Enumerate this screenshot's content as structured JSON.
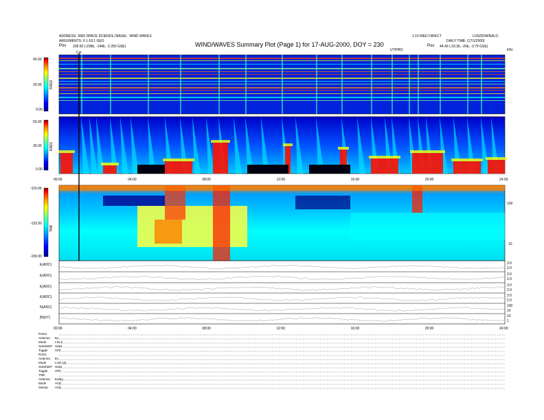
{
  "header": {
    "left_line1": "ADDRESS: 3000 SPACE SCIENCE (NASA) - WIND WAVES",
    "left_line2": "ARGUMENTS: 0.1-18.1 GEO",
    "left_pos_label": "Pos",
    "left_pos_value": "228.50 (-238b, -144b, -2.250 GSE)",
    "right_line1": "LOS/DOWN/A.D.",
    "right_line2": "DAILY TIME: (17/1/2000)",
    "right_pos_label": "Pos",
    "right_pos_value": "44.40 (-33.3b, -26b, -3.79 GSE)",
    "center_small": "1:10 WED DIRECT",
    "title": "WIND/WAVES Summary Plot (Page 1) for 17-AUG-2000, DOY = 230",
    "uthours": "UT/HRS",
    "khz": "kHz",
    "marker": "Cal",
    "mhz_top": "MHz",
    "label_rad2_right": "RAD2",
    "label_tnr_right": "RAD1"
  },
  "spectrograms": {
    "rad2": {
      "label": "RAD2",
      "ticks": [
        "40.00",
        "20.00",
        "0.00"
      ]
    },
    "rad1": {
      "label": "RAD1",
      "ticks": [
        "50.00",
        "30.00",
        "0.00"
      ]
    },
    "tnr": {
      "label": "TNR",
      "ticks": [
        "-115.00",
        "-132.50",
        "-150.00"
      ],
      "right_ticks": [
        "100",
        "10"
      ]
    }
  },
  "time_axis": {
    "labels": [
      "00:00",
      "04:00",
      "08:00",
      "12:00",
      "16:00",
      "20:00",
      "24:00"
    ],
    "bottom_labels": [
      "00:00",
      "04:00",
      "08:00",
      "12:00",
      "16:00",
      "20:00",
      "24:00"
    ]
  },
  "lineplots": [
    {
      "label": "E(ADC)",
      "right_ticks": [
        "3.0",
        "2.0"
      ]
    },
    {
      "label": "E(ADC)",
      "right_ticks": [
        "3.0",
        "2.0"
      ]
    },
    {
      "label": "E(ADC)",
      "right_ticks": [
        "3.0",
        "2.0"
      ]
    },
    {
      "label": "E(ADC)",
      "right_ticks": [
        "3.0",
        "2.0"
      ]
    },
    {
      "label": "N(ADC)",
      "right_ticks": [
        "100",
        "10"
      ]
    },
    {
      "label": "|B|(nT)",
      "right_ticks": [
        "10",
        "1"
      ]
    }
  ],
  "info_block": [
    {
      "k": "RAD2",
      "v": ""
    },
    {
      "k": "Antenna",
      "v": "Ey"
    },
    {
      "k": "Mode",
      "v": "LIN 3"
    },
    {
      "k": "SUM/SEP",
      "v": "SUM"
    },
    {
      "k": "Toggle",
      "v": "OFF"
    },
    {
      "k": "RAD1",
      "v": ""
    },
    {
      "k": "Antenna",
      "v": "Ex"
    },
    {
      "k": "Mode",
      "v": "LOG (4)"
    },
    {
      "k": "SUM/SEP",
      "v": "SUM"
    },
    {
      "k": "Toggle",
      "v": "OFF"
    },
    {
      "k": "TNR",
      "v": ""
    },
    {
      "k": "Antenna",
      "v": "Ex/Ey"
    },
    {
      "k": "Mode",
      "v": "ACE"
    },
    {
      "k": "Sweep",
      "v": "ACE"
    }
  ],
  "colors": {
    "colorbar": [
      "#7f0000",
      "#ff0000",
      "#ff8000",
      "#ffff00",
      "#80ff80",
      "#00ffff",
      "#0080ff",
      "#0000ff",
      "#00008f"
    ],
    "background": "#0022dd"
  },
  "chart_data": {
    "type": "heatmap",
    "title": "WIND/WAVES Summary Plot (Page 1) for 17-AUG-2000, DOY = 230",
    "xlabel": "UT/HRS",
    "x_range": [
      "00:00",
      "24:00"
    ],
    "panels": [
      {
        "name": "RAD2",
        "colorbar_ticks": [
          "40.00",
          "20.00",
          "0.00"
        ]
      },
      {
        "name": "RAD1",
        "colorbar_ticks": [
          "50.00",
          "30.00",
          "0.00"
        ]
      },
      {
        "name": "TNR",
        "colorbar_ticks": [
          "-115.00",
          "-132.50",
          "-150.00"
        ]
      }
    ]
  }
}
